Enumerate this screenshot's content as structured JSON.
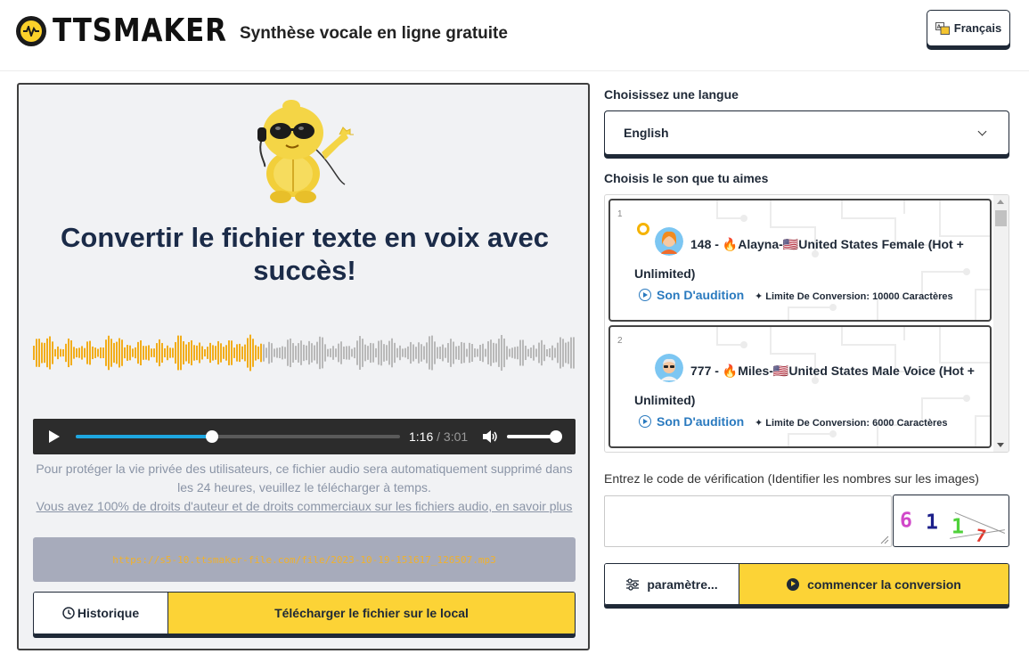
{
  "header": {
    "logo_text": "TTSMAKER",
    "tagline": "Synthèse vocale en ligne gratuite",
    "language_button": "Français"
  },
  "result": {
    "title": "Convertir le fichier texte en voix avec succès!",
    "player": {
      "current_time": "1:16",
      "separator": "/",
      "duration": "3:01",
      "progress": 0.42,
      "volume": 1.0
    },
    "notice_text": "Pour protéger la vie privée des utilisateurs, ce fichier audio sera automatiquement supprimé dans les 24 heures, veuillez le télécharger à temps.",
    "notice_link": "Vous avez 100% de droits d'auteur et de droits commerciaux sur les fichiers audio, en savoir plus",
    "file_url": "https://s5-10.ttsmaker-file.com/file/2023-10-19-151617_126507.mp3",
    "history_button": "Historique",
    "download_button": "Télécharger le fichier sur le local"
  },
  "language": {
    "label": "Choisissez une langue",
    "selected": "English"
  },
  "voices": {
    "label": "Choisis le son que tu aimes",
    "items": [
      {
        "index": "1",
        "name": "148 - 🔥Alayna-🇺🇸United States Female (Hot + Unlimited)",
        "audition": "Son D'audition",
        "limit": "Limite De Conversion: 10000 Caractères",
        "selected": true
      },
      {
        "index": "2",
        "name": "777 - 🔥Miles-🇺🇸United States Male Voice (Hot + Unlimited)",
        "audition": "Son D'audition",
        "limit": "Limite De Conversion: 6000 Caractères",
        "selected": false
      }
    ]
  },
  "verification": {
    "label": "Entrez le code de vérification (Identifier les nombres sur les images)",
    "value": "",
    "captcha_digits": "6117"
  },
  "bottom": {
    "settings_button": "paramètre...",
    "start_button": "commencer la conversion"
  },
  "colors": {
    "accent_yellow": "#fcd336",
    "dark": "#1f2937",
    "link_blue": "#2a7abf",
    "wave_played": "#f2ad1a",
    "wave_unplayed": "#b9b9b9"
  }
}
